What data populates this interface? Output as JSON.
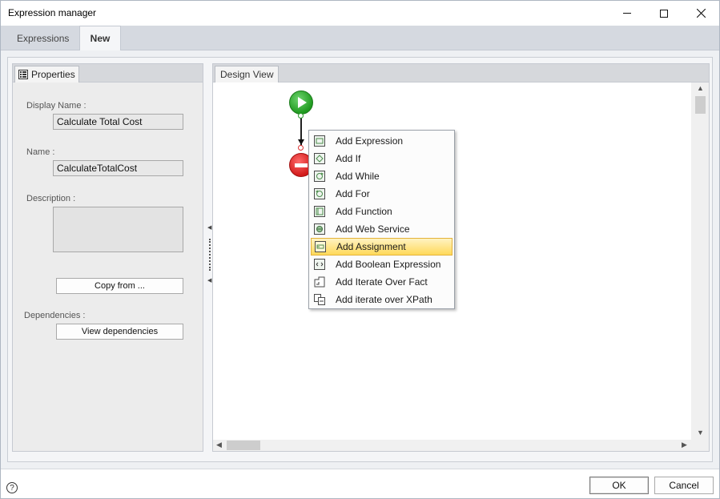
{
  "window": {
    "title": "Expression manager"
  },
  "tabs": [
    {
      "label": "Expressions",
      "active": false
    },
    {
      "label": "New",
      "active": true
    }
  ],
  "properties": {
    "tab_label": "Properties",
    "display_name_label": "Display Name :",
    "display_name_value": "Calculate Total Cost",
    "name_label": "Name :",
    "name_value": "CalculateTotalCost",
    "description_label": "Description :",
    "description_value": "",
    "copy_from_label": "Copy from ...",
    "dependencies_label": "Dependencies :",
    "view_dependencies_label": "View dependencies"
  },
  "design": {
    "tab_label": "Design View"
  },
  "context_menu": {
    "items": [
      {
        "label": "Add Expression",
        "icon": "expression-icon"
      },
      {
        "label": "Add If",
        "icon": "if-icon"
      },
      {
        "label": "Add While",
        "icon": "while-icon"
      },
      {
        "label": "Add For",
        "icon": "for-icon"
      },
      {
        "label": "Add Function",
        "icon": "function-icon"
      },
      {
        "label": "Add Web Service",
        "icon": "web-service-icon"
      },
      {
        "label": "Add Assignment",
        "icon": "assignment-icon",
        "highlighted": true
      },
      {
        "label": "Add Boolean Expression",
        "icon": "boolean-expression-icon"
      },
      {
        "label": "Add Iterate Over Fact",
        "icon": "iterate-fact-icon"
      },
      {
        "label": "Add iterate over XPath",
        "icon": "iterate-xpath-icon"
      }
    ]
  },
  "footer": {
    "ok_label": "OK",
    "cancel_label": "Cancel",
    "help_glyph": "?"
  },
  "colors": {
    "highlight_bg": "#ffd95a",
    "start_node": "#1f9a1f",
    "stop_node": "#d11a1a"
  }
}
